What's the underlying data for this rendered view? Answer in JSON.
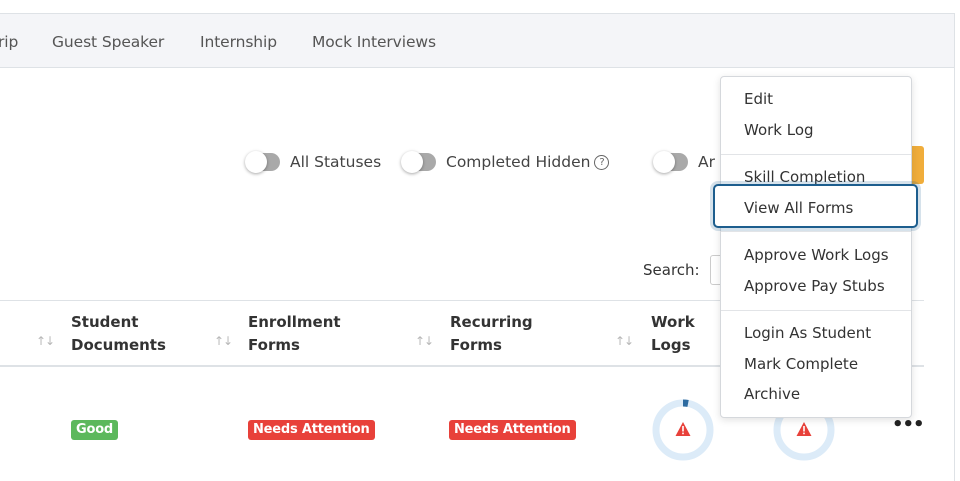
{
  "tabs": [
    "rip",
    "Guest Speaker",
    "Internship",
    "Mock Interviews"
  ],
  "filters": {
    "all_statuses": "All Statuses",
    "completed_hidden": "Completed Hidden",
    "help_glyph": "?",
    "archived_partial": "Ar"
  },
  "search": {
    "label": "Search:"
  },
  "table": {
    "columns": [
      {
        "line1": "Student",
        "line2": "Documents"
      },
      {
        "line1": "Enrollment",
        "line2": "Forms"
      },
      {
        "line1": "Recurring",
        "line2": "Forms"
      },
      {
        "line1": "Work",
        "line2": "Logs"
      }
    ],
    "sort_glyph": "↑↓",
    "row": {
      "student_documents": "Good",
      "enrollment_forms": "Needs Attention",
      "recurring_forms": "Needs Attention",
      "work_logs_progress": 0.03,
      "actions_glyph": "•••"
    }
  },
  "menu": {
    "items": [
      "Edit",
      "Work Log",
      "Skill Completion",
      "View All Forms",
      "Approve Work Logs",
      "Approve Pay Stubs",
      "Login As Student",
      "Mark Complete",
      "Archive"
    ],
    "focused": "View All Forms"
  },
  "colors": {
    "good": "#5cb85c",
    "needs_attention": "#e8413a",
    "accent": "#1d5e8e",
    "warning_button": "#f0ad3b",
    "ring_track": "#dcebf8",
    "ring_progress": "#2c6aa0",
    "alert_icon": "#e8413a"
  },
  "icons": {
    "alert": "warning-triangle-icon",
    "help": "question-circle-icon"
  }
}
